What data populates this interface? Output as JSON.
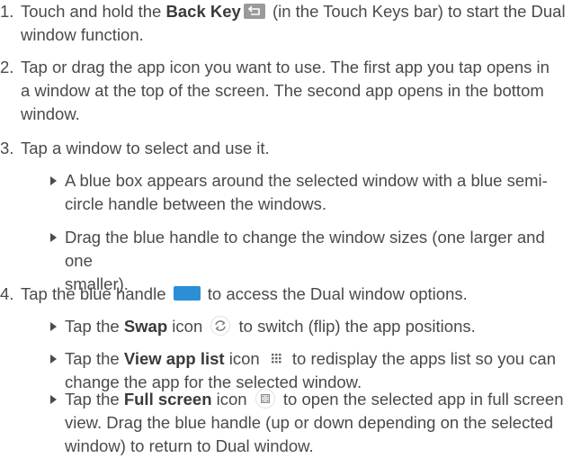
{
  "steps": [
    {
      "num": "1.",
      "pre": "Touch and hold the ",
      "bold": "Back Key",
      "post": " (in the Touch Keys bar) to start the Dual",
      "line2": "window function."
    },
    {
      "num": "2.",
      "line1": "Tap or drag the app icon you want to use. The first app you tap opens in",
      "line2": "a window at the top of the screen. The second app opens in the bottom",
      "line3": "window."
    },
    {
      "num": "3.",
      "line1": "Tap a window to select and use it."
    },
    {
      "num": "4.",
      "pre": "Tap the blue handle ",
      "post": " to access the Dual window options."
    }
  ],
  "bullets3": [
    {
      "line1": "A blue box appears around the selected window with a blue semi-",
      "line2": "circle handle between the windows."
    },
    {
      "line1": "Drag the blue handle to change the window sizes (one larger and one",
      "line2": "smaller)."
    }
  ],
  "bullets4": [
    {
      "pre": "Tap the ",
      "bold": "Swap",
      "mid": " icon ",
      "post": " to switch (flip) the app positions."
    },
    {
      "pre": "Tap the ",
      "bold": "View app list",
      "mid": " icon ",
      "post": " to redisplay the apps list so you can",
      "line2": "change the app for the selected window."
    },
    {
      "pre": "Tap the ",
      "bold": "Full screen",
      "mid": " icon ",
      "post": " to open the selected app in full screen",
      "line2": "view. Drag the blue handle (up or down depending on the selected",
      "line3": "window) to return to Dual window."
    }
  ],
  "icons": {
    "back_key": "back-arrow-icon",
    "handle": "blue-handle-icon",
    "swap": "swap-icon",
    "app_list": "grid-icon",
    "full_screen": "full-screen-icon"
  },
  "colors": {
    "text": "#4a4a4a",
    "handle_blue": "#2a8fd6",
    "key_gray": "#9a9a9a"
  }
}
